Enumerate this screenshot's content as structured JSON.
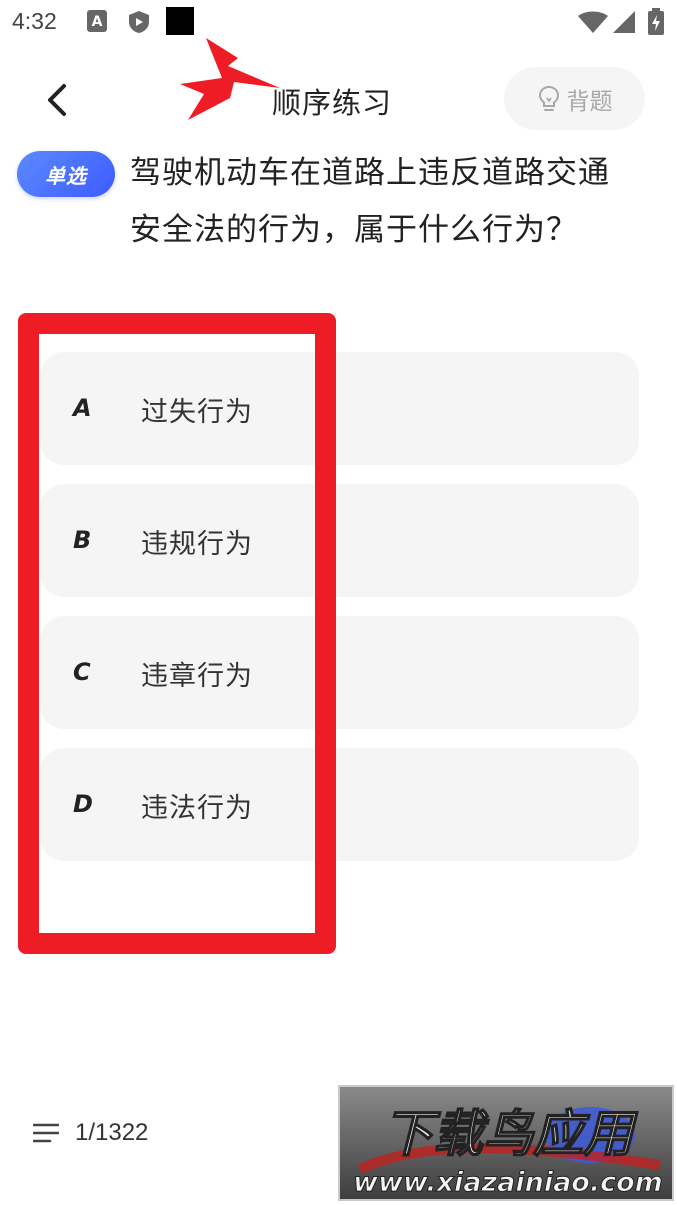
{
  "status_bar": {
    "time": "4:32",
    "icons": [
      "a-icon",
      "shield-icon",
      "black-square-icon",
      "wifi-icon",
      "signal-icon",
      "battery-icon"
    ]
  },
  "header": {
    "title": "顺序练习",
    "memorize_label": "背题",
    "icons": [
      "back-chevron-icon",
      "lightbulb-icon"
    ]
  },
  "question": {
    "type_badge": "单选",
    "text": "驾驶机动车在道路上违反道路交通安全法的行为，属于什么行为？"
  },
  "options": [
    {
      "letter": "A",
      "text": "过失行为"
    },
    {
      "letter": "B",
      "text": "违规行为"
    },
    {
      "letter": "C",
      "text": "违章行为"
    },
    {
      "letter": "D",
      "text": "违法行为"
    }
  ],
  "footer": {
    "progress": "1/1322",
    "icon": "list-icon"
  },
  "colors": {
    "accent": "#3d5bff",
    "annotation_red": "#ee1c24",
    "option_bg": "#f5f5f5",
    "muted": "#a8a8a8"
  },
  "watermark": {
    "title": "下载鸟应用",
    "url": "www.xiazainiao.com"
  }
}
